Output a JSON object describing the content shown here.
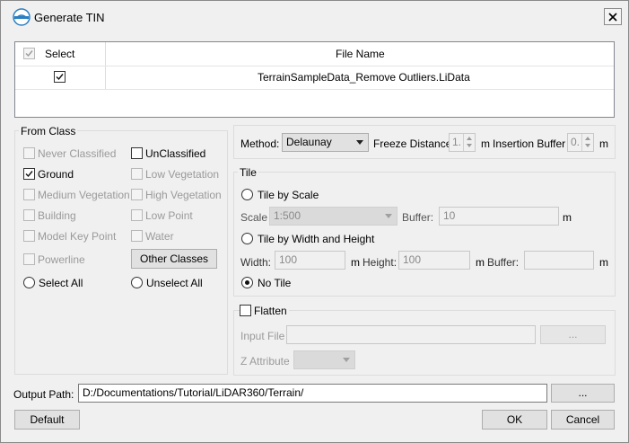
{
  "window": {
    "title": "Generate TIN",
    "close_glyph": "✕"
  },
  "file_table": {
    "headers": {
      "select": "Select",
      "file_name": "File Name"
    },
    "rows": [
      {
        "selected": true,
        "file_name": "TerrainSampleData_Remove Outliers.LiData"
      }
    ]
  },
  "from_class": {
    "title": "From Class",
    "items": [
      {
        "label": "Never Classified",
        "checked": false,
        "enabled": false
      },
      {
        "label": "UnClassified",
        "checked": false,
        "enabled": true
      },
      {
        "label": "Ground",
        "checked": true,
        "enabled": true
      },
      {
        "label": "Low Vegetation",
        "checked": false,
        "enabled": false
      },
      {
        "label": "Medium Vegetation",
        "checked": false,
        "enabled": false
      },
      {
        "label": "High Vegetation",
        "checked": false,
        "enabled": false
      },
      {
        "label": "Building",
        "checked": false,
        "enabled": false
      },
      {
        "label": "Low Point",
        "checked": false,
        "enabled": false
      },
      {
        "label": "Model Key Point",
        "checked": false,
        "enabled": false
      },
      {
        "label": "Water",
        "checked": false,
        "enabled": false
      },
      {
        "label": "Powerline",
        "checked": false,
        "enabled": false
      }
    ],
    "other_classes": "Other Classes",
    "select_all": "Select All",
    "unselect_all": "Unselect All"
  },
  "method": {
    "label": "Method:",
    "value": "Delaunay",
    "freeze_distance_label": "Freeze Distance",
    "freeze_distance_value": "1.",
    "freeze_unit": "m",
    "insertion_buffer_label": "Insertion Buffer",
    "insertion_buffer_value": "0.",
    "insertion_unit": "m"
  },
  "tile": {
    "title": "Tile",
    "by_scale": "Tile by Scale",
    "scale_label": "Scale",
    "scale_value": "1:500",
    "buffer_label": "Buffer:",
    "buffer_value": "10",
    "buffer_unit": "m",
    "by_width_height": "Tile by Width and Height",
    "width_label": "Width:",
    "width_value": "100",
    "width_unit": "m",
    "height_label": "Height:",
    "height_value": "100",
    "height_unit": "m",
    "buffer2_label": "Buffer:",
    "buffer2_value": "",
    "buffer2_unit": "m",
    "no_tile": "No Tile",
    "selected": "no_tile"
  },
  "flatten": {
    "label": "Flatten",
    "checked": false,
    "input_file_label": "Input File",
    "input_file_value": "",
    "browse": "...",
    "z_attribute_label": "Z Attribute",
    "z_attribute_value": ""
  },
  "output": {
    "label": "Output Path:",
    "value": "D:/Documentations/Tutorial/LiDAR360/Terrain/",
    "browse": "..."
  },
  "buttons": {
    "default": "Default",
    "ok": "OK",
    "cancel": "Cancel"
  }
}
